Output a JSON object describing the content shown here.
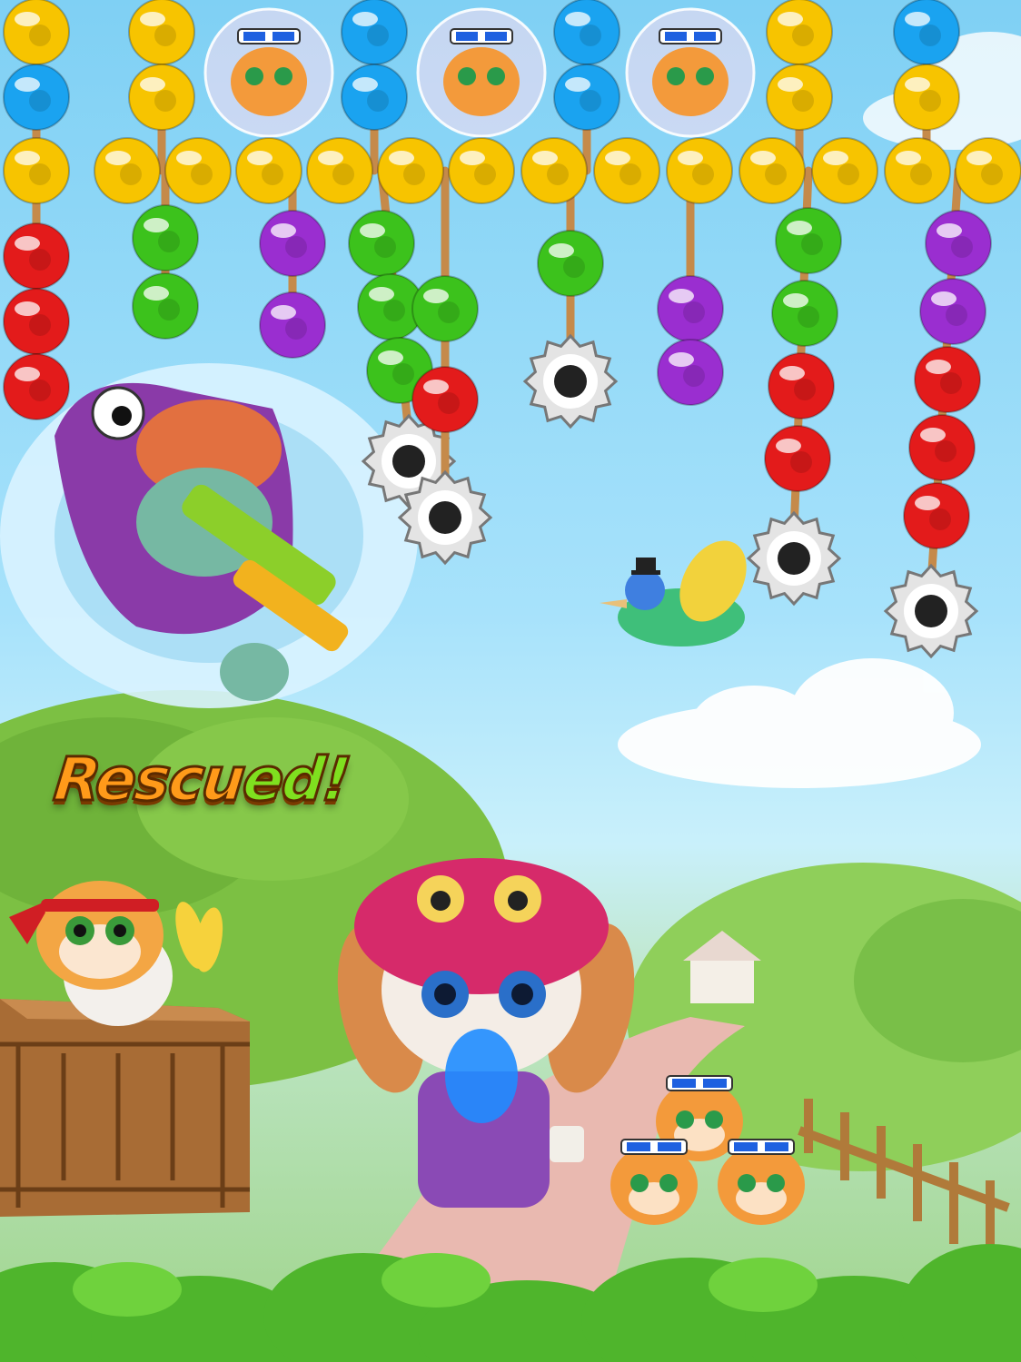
{
  "banner": {
    "part1": "Rescu",
    "part2": "ed!"
  },
  "colors": {
    "yellow": "#f7c400",
    "blue": "#1aa3f0",
    "green": "#3cc21c",
    "purple": "#9a2ed0",
    "red": "#e31b1b",
    "rope": "#c58a4a",
    "banner_orange": "#ff9a1a",
    "banner_green": "#7fe01f"
  },
  "top_row": [
    "yellow",
    "yellow",
    "yellow",
    "yellow",
    "yellow",
    "yellow",
    "yellow",
    "yellow",
    "yellow",
    "yellow",
    "yellow",
    "yellow",
    "yellow",
    "yellow"
  ],
  "upper_chains": [
    [
      "yellow",
      "blue"
    ],
    [
      "yellow",
      "yellow"
    ],
    [
      "tiger-bubble"
    ],
    [
      "blue",
      "blue"
    ],
    [
      "tiger-bubble"
    ],
    [
      "blue",
      "blue"
    ],
    [
      "tiger-bubble"
    ],
    [
      "yellow",
      "yellow"
    ],
    [
      "blue",
      "yellow"
    ]
  ],
  "hanging_chains": [
    [
      "red",
      "red",
      "red"
    ],
    [
      "green",
      "green"
    ],
    [
      "purple",
      "purple"
    ],
    [
      "green",
      "green",
      "green",
      "saw"
    ],
    [
      "green",
      "saw"
    ],
    [
      "green",
      "red",
      "saw"
    ],
    [
      "purple",
      "purple"
    ],
    [
      "green",
      "green",
      "red",
      "red",
      "saw"
    ],
    [
      "purple",
      "purple",
      "red",
      "red",
      "red",
      "saw"
    ]
  ],
  "characters": [
    "zombie-with-water-gun",
    "rescued-hamster-on-crate",
    "bunny-with-owl-hat",
    "tiger-cub-group",
    "flying-parrot"
  ]
}
